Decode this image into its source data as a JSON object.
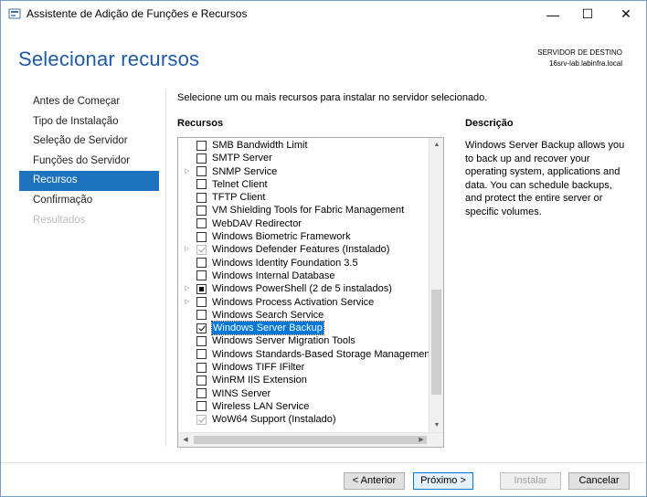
{
  "window": {
    "title": "Assistente de Adição de Funções e Recursos",
    "minimize": "—",
    "maximize": "☐",
    "close": "✕"
  },
  "header": {
    "title": "Selecionar recursos",
    "destination_label": "SERVIDOR DE DESTINO",
    "destination_server": "16srv-lab.labinfra.local"
  },
  "nav": {
    "items": [
      {
        "label": "Antes de Começar",
        "state": "normal"
      },
      {
        "label": "Tipo de Instalação",
        "state": "normal"
      },
      {
        "label": "Seleção de Servidor",
        "state": "normal"
      },
      {
        "label": "Funções do Servidor",
        "state": "normal"
      },
      {
        "label": "Recursos",
        "state": "active"
      },
      {
        "label": "Confirmação",
        "state": "normal"
      },
      {
        "label": "Resultados",
        "state": "disabled"
      }
    ]
  },
  "main": {
    "instruction": "Selecione um ou mais recursos para instalar no servidor selecionado.",
    "features_header": "Recursos",
    "description_header": "Descrição",
    "description_text": "Windows Server Backup allows you to back up and recover your operating system, applications and data. You can schedule backups, and protect the entire server or specific volumes.",
    "features": [
      {
        "label": "SMB Bandwidth Limit",
        "expandable": false,
        "state": "unchecked"
      },
      {
        "label": "SMTP Server",
        "expandable": false,
        "state": "unchecked"
      },
      {
        "label": "SNMP Service",
        "expandable": true,
        "state": "unchecked"
      },
      {
        "label": "Telnet Client",
        "expandable": false,
        "state": "unchecked"
      },
      {
        "label": "TFTP Client",
        "expandable": false,
        "state": "unchecked"
      },
      {
        "label": "VM Shielding Tools for Fabric Management",
        "expandable": false,
        "state": "unchecked"
      },
      {
        "label": "WebDAV Redirector",
        "expandable": false,
        "state": "unchecked"
      },
      {
        "label": "Windows Biometric Framework",
        "expandable": false,
        "state": "unchecked"
      },
      {
        "label": "Windows Defender Features (Instalado)",
        "expandable": true,
        "state": "checked-disabled"
      },
      {
        "label": "Windows Identity Foundation 3.5",
        "expandable": false,
        "state": "unchecked"
      },
      {
        "label": "Windows Internal Database",
        "expandable": false,
        "state": "unchecked"
      },
      {
        "label": "Windows PowerShell (2 de 5 instalados)",
        "expandable": true,
        "state": "partial"
      },
      {
        "label": "Windows Process Activation Service",
        "expandable": true,
        "state": "unchecked"
      },
      {
        "label": "Windows Search Service",
        "expandable": false,
        "state": "unchecked"
      },
      {
        "label": "Windows Server Backup",
        "expandable": false,
        "state": "checked",
        "selected": true
      },
      {
        "label": "Windows Server Migration Tools",
        "expandable": false,
        "state": "unchecked"
      },
      {
        "label": "Windows Standards-Based Storage Management",
        "expandable": false,
        "state": "unchecked"
      },
      {
        "label": "Windows TIFF IFilter",
        "expandable": false,
        "state": "unchecked"
      },
      {
        "label": "WinRM IIS Extension",
        "expandable": false,
        "state": "unchecked"
      },
      {
        "label": "WINS Server",
        "expandable": false,
        "state": "unchecked"
      },
      {
        "label": "Wireless LAN Service",
        "expandable": false,
        "state": "unchecked"
      },
      {
        "label": "WoW64 Support (Instalado)",
        "expandable": false,
        "state": "checked-disabled"
      }
    ],
    "scroll_position": 0.85
  },
  "footer": {
    "previous": "< Anterior",
    "next": "Próximo >",
    "install": "Instalar",
    "cancel": "Cancelar"
  },
  "colors": {
    "accent": "#1e73be",
    "title_blue": "#1e5aa6",
    "selection": "#0078d7"
  },
  "icons": {
    "expander": "▷",
    "scroll_up": "▲",
    "scroll_down": "▼",
    "scroll_left": "◀",
    "scroll_right": "▶"
  }
}
